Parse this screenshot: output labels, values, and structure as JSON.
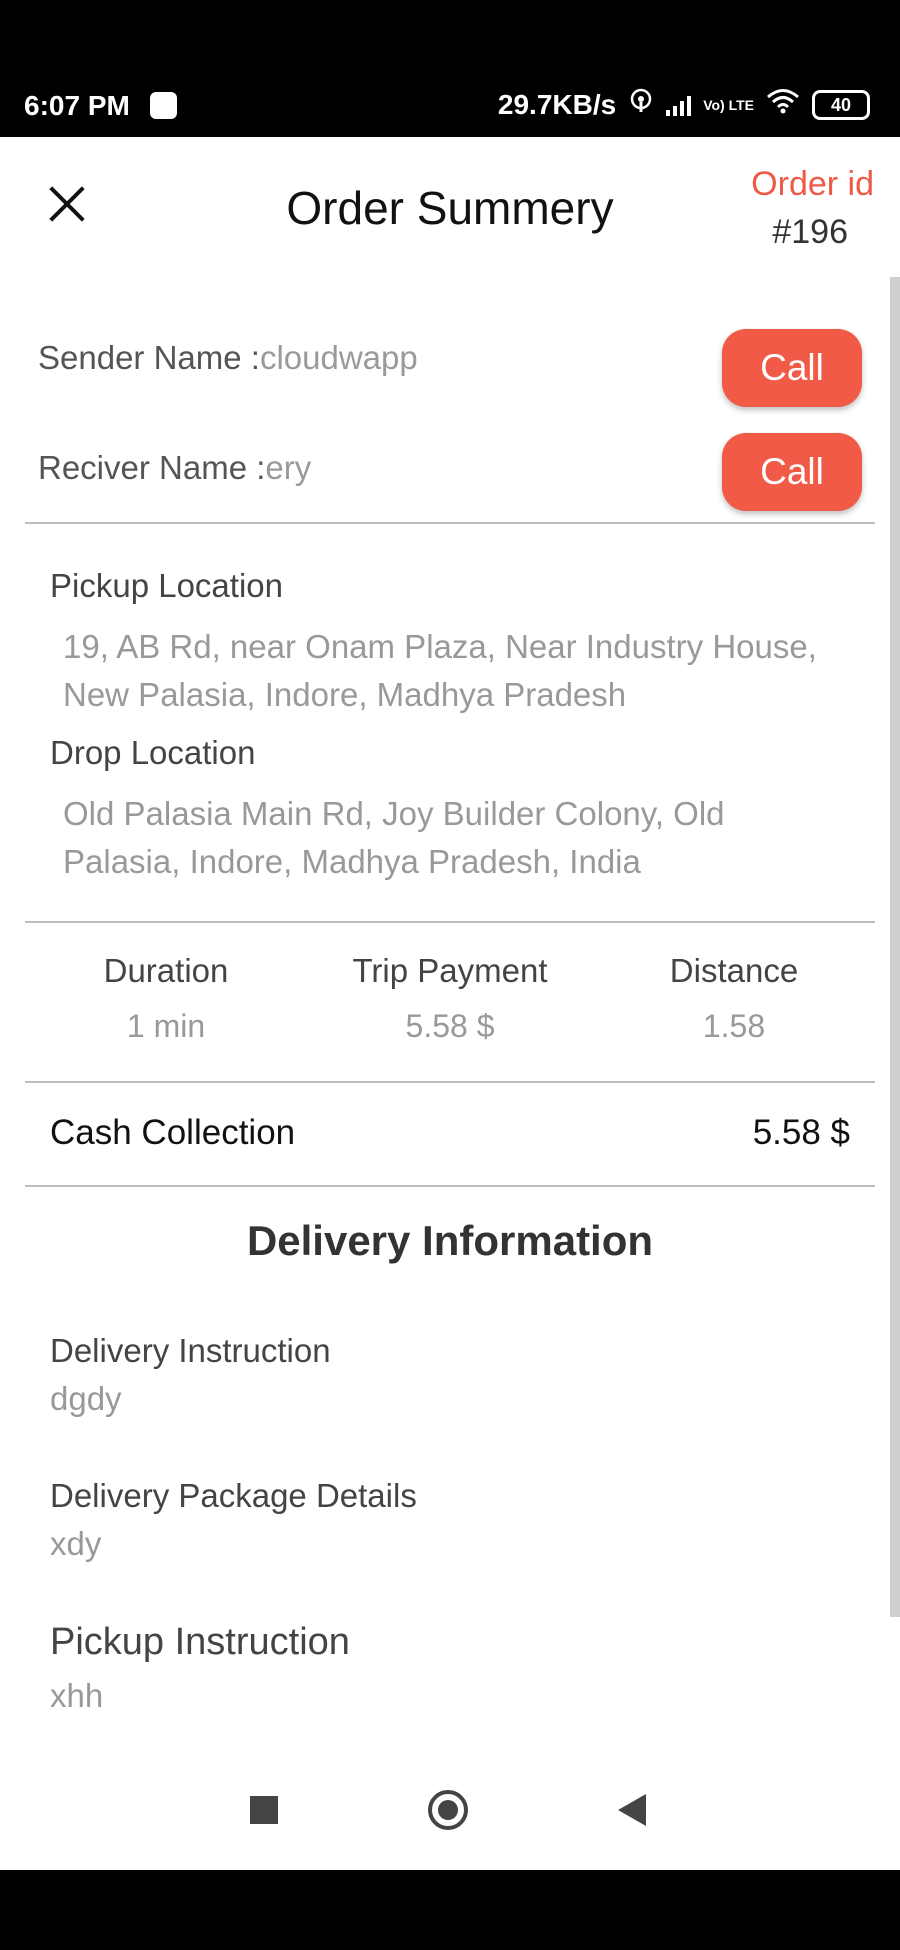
{
  "status_bar": {
    "time": "6:07 PM",
    "network_speed": "29.7KB/s",
    "volte": "Vo) LTE",
    "battery": "40",
    "icons": [
      "notification-icon",
      "hotspot-icon",
      "signal-icon",
      "wifi-icon",
      "battery-icon"
    ]
  },
  "header": {
    "close_icon": "close-icon",
    "title": "Order Summery",
    "order_id_label": "Order id",
    "order_id_value": "#196"
  },
  "contacts": {
    "sender_label": "Sender Name :",
    "sender_value": "cloudwapp",
    "receiver_label": "Reciver Name :",
    "receiver_value": "ery",
    "call_label": "Call"
  },
  "locations": {
    "pickup_label": "Pickup Location",
    "pickup_address": "19, AB Rd, near Onam Plaza, Near Industry House, New Palasia, Indore, Madhya Pradesh",
    "drop_label": "Drop Location",
    "drop_address": "Old Palasia Main Rd, Joy Builder Colony, Old Palasia, Indore, Madhya Pradesh, India"
  },
  "stats": {
    "duration_label": "Duration",
    "duration_value": "1 min",
    "payment_label": "Trip Payment",
    "payment_value": "5.58 $",
    "distance_label": "Distance",
    "distance_value": "1.58"
  },
  "cash": {
    "label": "Cash Collection",
    "value": "5.58 $"
  },
  "delivery": {
    "heading": "Delivery Information",
    "instruction_label": "Delivery Instruction",
    "instruction_value": "dgdy",
    "package_label": "Delivery Package Details",
    "package_value": "xdy",
    "pickup_instruction_label": "Pickup Instruction",
    "pickup_instruction_value": "xhh"
  },
  "nav": {
    "icons": [
      "recents-icon",
      "home-icon",
      "back-icon"
    ]
  },
  "colors": {
    "accent": "#f15a47",
    "text_dark": "#111111",
    "text_muted": "#999999"
  }
}
